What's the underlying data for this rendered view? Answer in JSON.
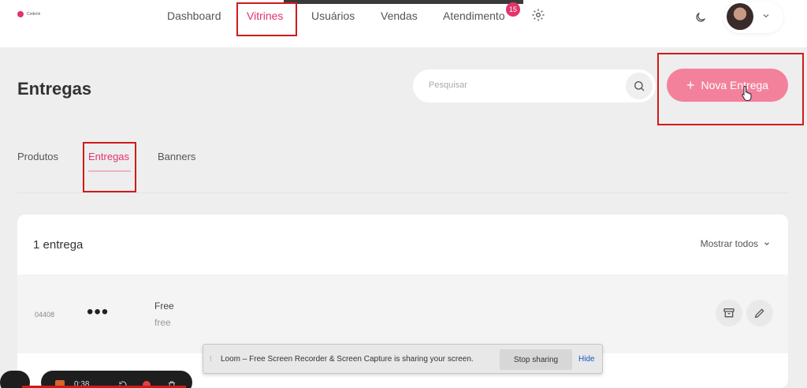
{
  "app": {
    "logo_text": "Codemi"
  },
  "nav": {
    "items": [
      {
        "label": "Dashboard"
      },
      {
        "label": "Vitrines"
      },
      {
        "label": "Usuários"
      },
      {
        "label": "Vendas"
      },
      {
        "label": "Atendimento"
      }
    ],
    "active": "Vitrines",
    "notification_count": "15",
    "icons": {
      "settings": "gear-icon",
      "theme": "moon-icon",
      "menu": "chevron-down-icon"
    }
  },
  "page": {
    "title": "Entregas",
    "search_placeholder": "Pesquisar",
    "new_button": "Nova Entrega",
    "new_button_icon": "+"
  },
  "tabs": [
    {
      "label": "Produtos"
    },
    {
      "label": "Entregas"
    },
    {
      "label": "Banners"
    }
  ],
  "card": {
    "count_label": "1 entrega",
    "show_all": "Mostrar todos",
    "rows": [
      {
        "id": "04408",
        "menu": "•••",
        "name": "Free",
        "price": "free"
      }
    ]
  },
  "screen_share": {
    "message": "Loom – Free Screen Recorder & Screen Capture is sharing your screen.",
    "stop": "Stop sharing",
    "hide": "Hide"
  },
  "loom": {
    "time": "0:38"
  },
  "colors": {
    "accent": "#e2336b",
    "cta": "#f3819c",
    "highlight": "#d01a1a"
  }
}
